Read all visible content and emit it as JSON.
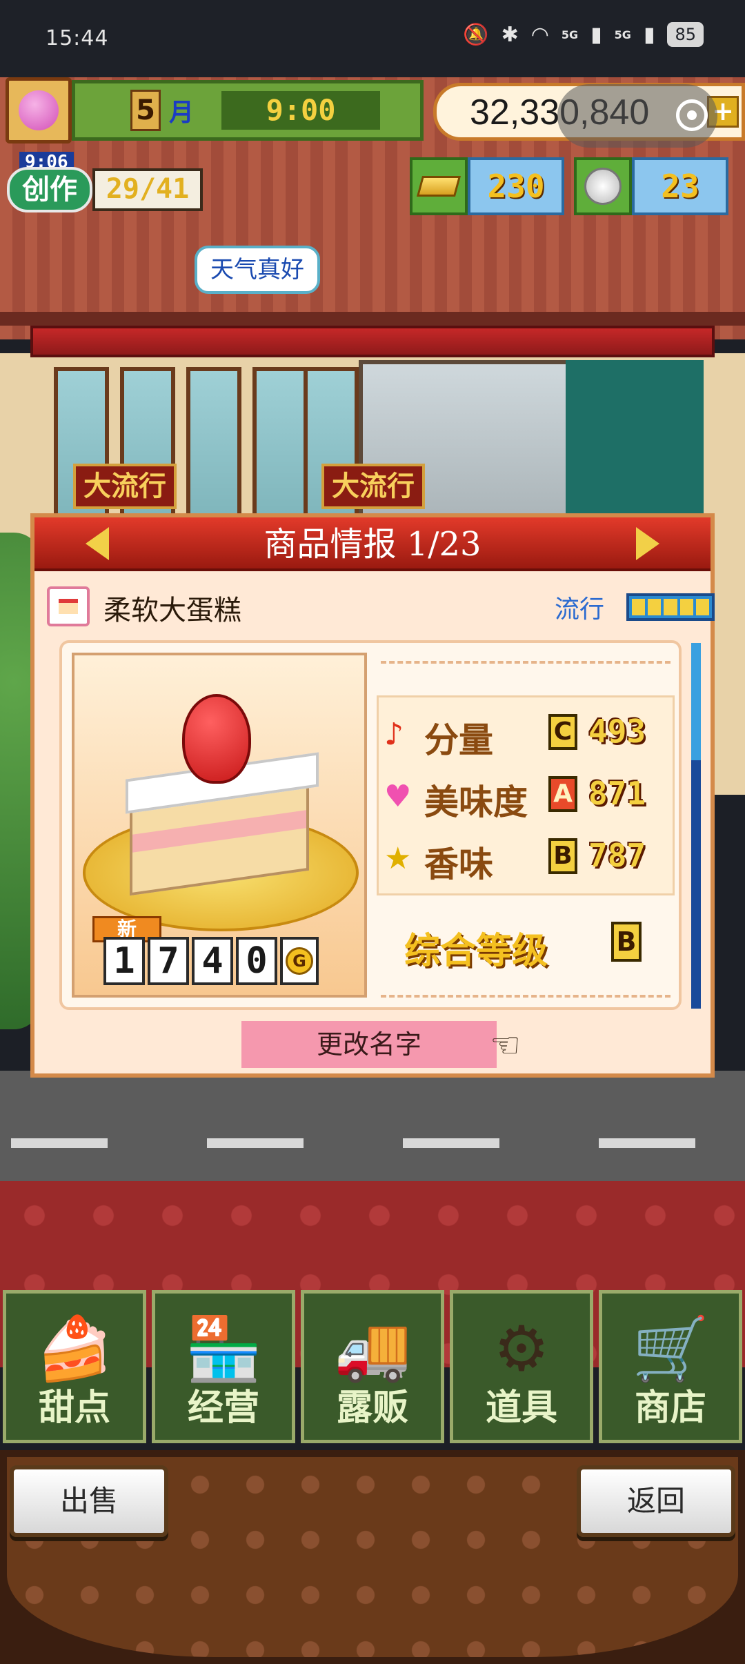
{
  "status_bar": {
    "time": "15:44",
    "battery": "85",
    "signal_1": "5G",
    "signal_2": "5G"
  },
  "hud": {
    "month_number": "5",
    "month_label": "月",
    "clock": "9:00",
    "money": "32,330,840",
    "create_timer": "9:06",
    "create_label": "创作",
    "create_count": "29/41",
    "gold_bars": "230",
    "medals": "23"
  },
  "scene": {
    "speech_bubble": "天气真好",
    "banner_left": "大流行",
    "banner_right": "大流行"
  },
  "panel": {
    "title": "商品情报",
    "page": "1/23",
    "product_name": "柔软大蛋糕",
    "trend_label": "流行",
    "trend_level": 5,
    "new_tag": "新",
    "price_digits": [
      "1",
      "7",
      "4",
      "0"
    ],
    "price_unit": "G",
    "stats": [
      {
        "label": "分量",
        "grade": "C",
        "value": "493",
        "icon": "music-note-icon"
      },
      {
        "label": "美味度",
        "grade": "A",
        "value": "871",
        "icon": "heart-icon"
      },
      {
        "label": "香味",
        "grade": "B",
        "value": "787",
        "icon": "star-icon"
      }
    ],
    "overall_label": "综合等级",
    "overall_grade": "B",
    "rename_button": "更改名字"
  },
  "menu": {
    "items": [
      {
        "label": "甜点",
        "icon": "cake-icon"
      },
      {
        "label": "经营",
        "icon": "shop-icon"
      },
      {
        "label": "露贩",
        "icon": "food-truck-icon"
      },
      {
        "label": "道具",
        "icon": "gear-bag-icon"
      },
      {
        "label": "商店",
        "icon": "cart-icon"
      }
    ]
  },
  "footer": {
    "sell_button": "出售",
    "back_button": "返回"
  },
  "colors": {
    "panel_header": "#c62828",
    "rename_button": "#f598ae",
    "menu_bg": "#3a5a2a"
  }
}
